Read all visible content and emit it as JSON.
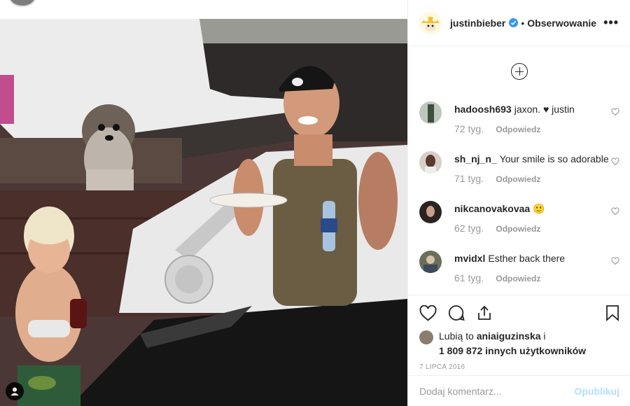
{
  "post": {
    "author": "justinbieber",
    "verified": true,
    "separator": "•",
    "follow_label": "Obserwowanie",
    "more_label": "•••"
  },
  "comments": [
    {
      "user": "hadoosh693",
      "text": "jaxon. ♥ justin",
      "time": "72 tyg.",
      "reply": "Odpowiedz"
    },
    {
      "user": "sh_nj_n_",
      "text": "Your smile is so adorable",
      "time": "71 tyg.",
      "reply": "Odpowiedz"
    },
    {
      "user": "nikcanovakovaa",
      "text": "🙂",
      "time": "62 tyg.",
      "reply": "Odpowiedz"
    },
    {
      "user": "mvidxl",
      "text": "Esther back there",
      "time": "61 tyg.",
      "reply": "Odpowiedz"
    }
  ],
  "likes": {
    "prefix": "Lubią to",
    "user": "aniaiguzinska",
    "suffix": "i",
    "others": "1 809 872 innych użytkowników"
  },
  "date": "7 LIPCA 2016",
  "add_comment": {
    "placeholder": "Dodaj komentarz...",
    "post_label": "Opublikuj"
  },
  "colors": {
    "verified": "#3897f0",
    "post_button_disabled": "#b2dffc",
    "meta_text": "#999999"
  }
}
